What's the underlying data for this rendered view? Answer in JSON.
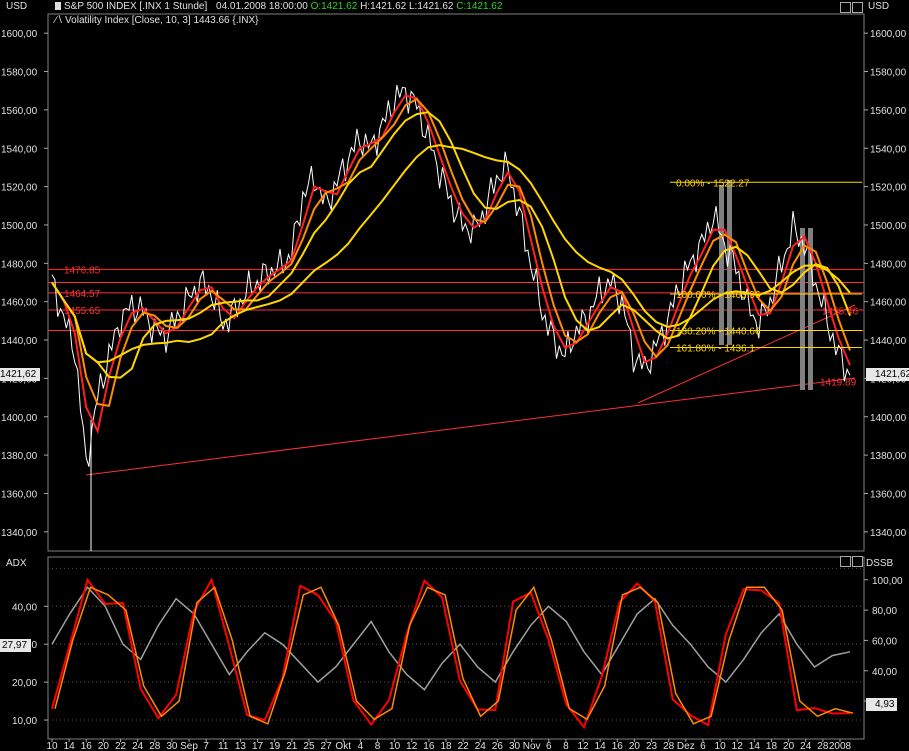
{
  "header": {
    "currency_left": "USD",
    "currency_right": "USD",
    "symbol_line": "S&P 500 INDEX [.INX  1 Stunde]",
    "datetime": "04.01.2008 18:00:00",
    "ohlc_o": "O:1421.62",
    "ohlc_h": "H:1421.62",
    "ohlc_l": "L:1421.62",
    "ohlc_c": "C:1421.62",
    "indicator_line": "Volatility Index [Close, 10, 3]",
    "indicator_value": "1443.66",
    "indicator_symbol": "{.INX}"
  },
  "lower_panel": {
    "label_left": "ADX",
    "label_right": "DSSB"
  },
  "price_tag": "1421,62",
  "adx_tag": "27,97",
  "dssb_tag": "4,93",
  "colors": {
    "background": "#000000",
    "price": "#ffffff",
    "ma_red": "#ff2020",
    "ma_orange": "#ff8c00",
    "ma_yellow": "#ffd700",
    "ma_green_dashed": "#33cc33",
    "hlines": "#ff3030",
    "fib": "#ffd700",
    "adx": "#a0a0a0",
    "dssb": "#ff0000"
  },
  "chart_data": [
    {
      "type": "line",
      "ylim": [
        1330,
        1610
      ],
      "yticks": [
        "1340,00",
        "1360,00",
        "1380,00",
        "1400,00",
        "1420,00",
        "1440,00",
        "1460,00",
        "1480,00",
        "1500,00",
        "1520,00",
        "1540,00",
        "1560,00",
        "1580,00",
        "1600,00"
      ],
      "ytick_values": [
        1340,
        1360,
        1380,
        1400,
        1420,
        1440,
        1460,
        1480,
        1500,
        1520,
        1540,
        1560,
        1580,
        1600
      ],
      "price_path": [
        1470,
        1452,
        1435,
        1375,
        1410,
        1432,
        1450,
        1458,
        1455,
        1445,
        1442,
        1452,
        1462,
        1470,
        1465,
        1448,
        1455,
        1465,
        1470,
        1476,
        1478,
        1485,
        1515,
        1525,
        1510,
        1522,
        1535,
        1545,
        1540,
        1552,
        1565,
        1570,
        1562,
        1545,
        1528,
        1512,
        1500,
        1497,
        1508,
        1525,
        1530,
        1505,
        1480,
        1455,
        1440,
        1432,
        1445,
        1452,
        1465,
        1470,
        1460,
        1432,
        1425,
        1437,
        1450,
        1468,
        1480,
        1490,
        1505,
        1490,
        1478,
        1458,
        1448,
        1460,
        1480,
        1498,
        1490,
        1470,
        1450,
        1432,
        1421.62
      ],
      "horizontal_lines": [
        {
          "value": 1476.85,
          "label": "1476.85"
        },
        {
          "value": 1464.57,
          "label": "1464.57"
        },
        {
          "value": 1455.65,
          "label": "1455.65"
        },
        {
          "value": 1445.0,
          "label": ""
        },
        {
          "value": 1470.0,
          "label": ""
        }
      ],
      "fib_levels": [
        {
          "value": 1522.27,
          "label": "0.00% - 1522.27"
        },
        {
          "value": 1464.0,
          "label": "100.00% - 1463.96"
        },
        {
          "value": 1445.0,
          "label": "130.20% - 1440.66"
        },
        {
          "value": 1436.1,
          "label": "161.80% - 1436.1"
        }
      ],
      "annotations": [
        "1419.89",
        "1455.46"
      ],
      "xtick_labels": [
        "10",
        "14",
        "16",
        "20",
        "22",
        "24",
        "28",
        "30",
        "Sep",
        "7",
        "11",
        "13",
        "17",
        "19",
        "21",
        "25",
        "27",
        "Okt",
        "4",
        "8",
        "10",
        "12",
        "16",
        "18",
        "22",
        "24",
        "26",
        "30",
        "Nov",
        "6",
        "8",
        "12",
        "14",
        "16",
        "20",
        "23",
        "28",
        "Dez",
        "6",
        "10",
        "12",
        "14",
        "18",
        "20",
        "24",
        "28",
        "2008"
      ]
    },
    {
      "type": "line",
      "ylim": [
        5,
        53
      ],
      "yticks_left": [
        "10,00",
        "20,00",
        "30,00",
        "40,00"
      ],
      "ytick_left_values": [
        10,
        20,
        30,
        40
      ],
      "yticks_right": [
        "20,00",
        "40,00",
        "60,00",
        "80,00",
        "100,00"
      ],
      "ytick_right_values": [
        20,
        40,
        60,
        80,
        100
      ],
      "series": [
        {
          "name": "ADX",
          "values": [
            30,
            38,
            45,
            40,
            30,
            26,
            35,
            42,
            38,
            30,
            22,
            28,
            33,
            30,
            25,
            20,
            24,
            30,
            36,
            28,
            22,
            18,
            25,
            30,
            24,
            20,
            28,
            35,
            40,
            36,
            28,
            22,
            30,
            38,
            42,
            35,
            30,
            24,
            20,
            26,
            33,
            38,
            30,
            24,
            27,
            28
          ]
        },
        {
          "name": "DSSB",
          "values": [
            15,
            60,
            95,
            90,
            80,
            30,
            10,
            20,
            85,
            95,
            60,
            10,
            5,
            40,
            90,
            95,
            70,
            20,
            8,
            15,
            70,
            95,
            90,
            35,
            10,
            20,
            80,
            95,
            60,
            15,
            8,
            30,
            90,
            95,
            85,
            25,
            5,
            10,
            60,
            95,
            95,
            80,
            20,
            10,
            15,
            12
          ]
        }
      ]
    }
  ]
}
